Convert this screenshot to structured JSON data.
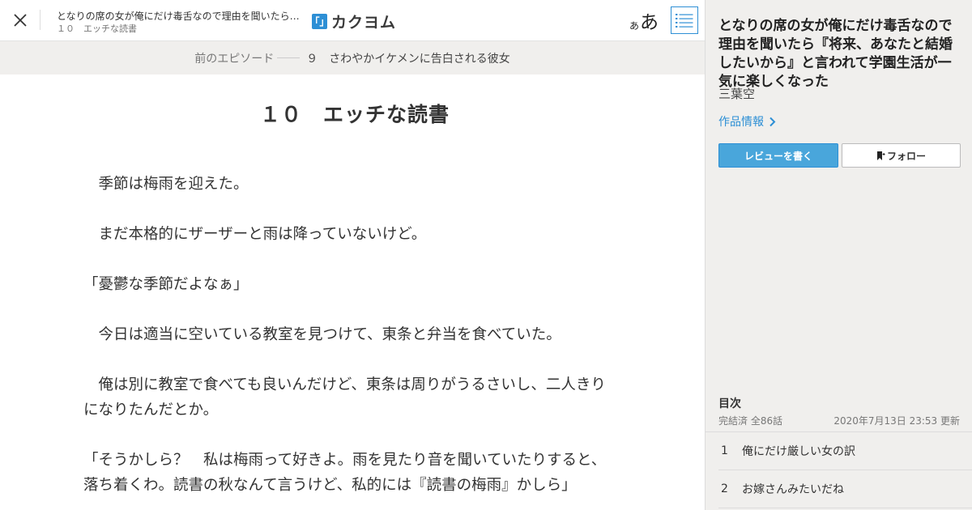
{
  "header": {
    "work_title_short": "となりの席の女が俺にだけ毒舌なので理由を聞いたら…",
    "episode_short": "１０　エッチな読書",
    "brand_mark": "「」",
    "brand_name": "カクヨム",
    "font_size_small": "あ",
    "font_size_large": "あ",
    "close_icon": "close-icon",
    "toc_icon": "list-icon"
  },
  "prev_episode": {
    "label": "前のエピソード",
    "title": "９　さわやかイケメンに告白される彼女"
  },
  "episode": {
    "title": "１０　エッチな読書",
    "paragraphs": [
      "　季節は梅雨を迎えた。",
      "　まだ本格的にザーザーと雨は降っていないけど。",
      "「憂鬱な季節だよなぁ」",
      "　今日は適当に空いている教室を見つけて、東条と弁当を食べていた。",
      "　俺は別に教室で食べても良いんだけど、東条は周りがうるさいし、二人きりになりたんだとか。",
      "「そうかしら？　私は梅雨って好きよ。雨を見たり音を聞いていたりすると、落ち着くわ。読書の秋なんて言うけど、私的には『読書の梅雨』かしら」"
    ]
  },
  "sidebar": {
    "title": "となりの席の女が俺にだけ毒舌なので理由を聞いたら『将来、あなたと結婚したいから』と言われて学園生活が一気に楽しくなった",
    "author": "三葉空",
    "work_info": "作品情報",
    "review_button": "レビューを書く",
    "follow_button": "フォロー",
    "toc_heading": "目次",
    "toc_status": "完結済 全86話",
    "toc_updated": "2020年7月13日 23:53 更新",
    "toc_items": [
      {
        "num": "1",
        "title": "俺にだけ厳しい女の訳"
      },
      {
        "num": "2",
        "title": "お嫁さんみたいだね"
      }
    ]
  },
  "colors": {
    "accent": "#2d8fd5",
    "button_fill": "#49a6db",
    "sidebar_bg": "#f0efed"
  }
}
